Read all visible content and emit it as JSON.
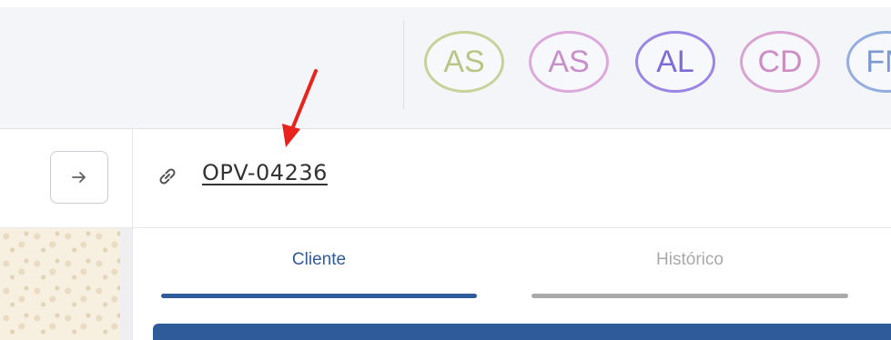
{
  "header": {
    "avatars": [
      {
        "initials": "AS",
        "color": "#c7d29b",
        "text_color": "#b9c584"
      },
      {
        "initials": "AS",
        "color": "#dca9dc",
        "text_color": "#c98fc9"
      },
      {
        "initials": "AL",
        "color": "#9b86e4",
        "text_color": "#7f69d6"
      },
      {
        "initials": "CD",
        "color": "#d9a3d2",
        "text_color": "#cd8cc3"
      },
      {
        "initials": "FN",
        "color": "#93aede",
        "text_color": "#7b99cf"
      }
    ]
  },
  "record": {
    "id": "OPV-04236",
    "nav_icon": "arrow-right-icon",
    "link_icon": "link-icon"
  },
  "tabs": [
    {
      "label": "Cliente",
      "active": true,
      "color": "#2f5b9a"
    },
    {
      "label": "Histórico",
      "active": false,
      "color": "#a9a9a9"
    }
  ],
  "colors": {
    "accent": "#2f5b9a",
    "annotation": "#e8231d"
  }
}
